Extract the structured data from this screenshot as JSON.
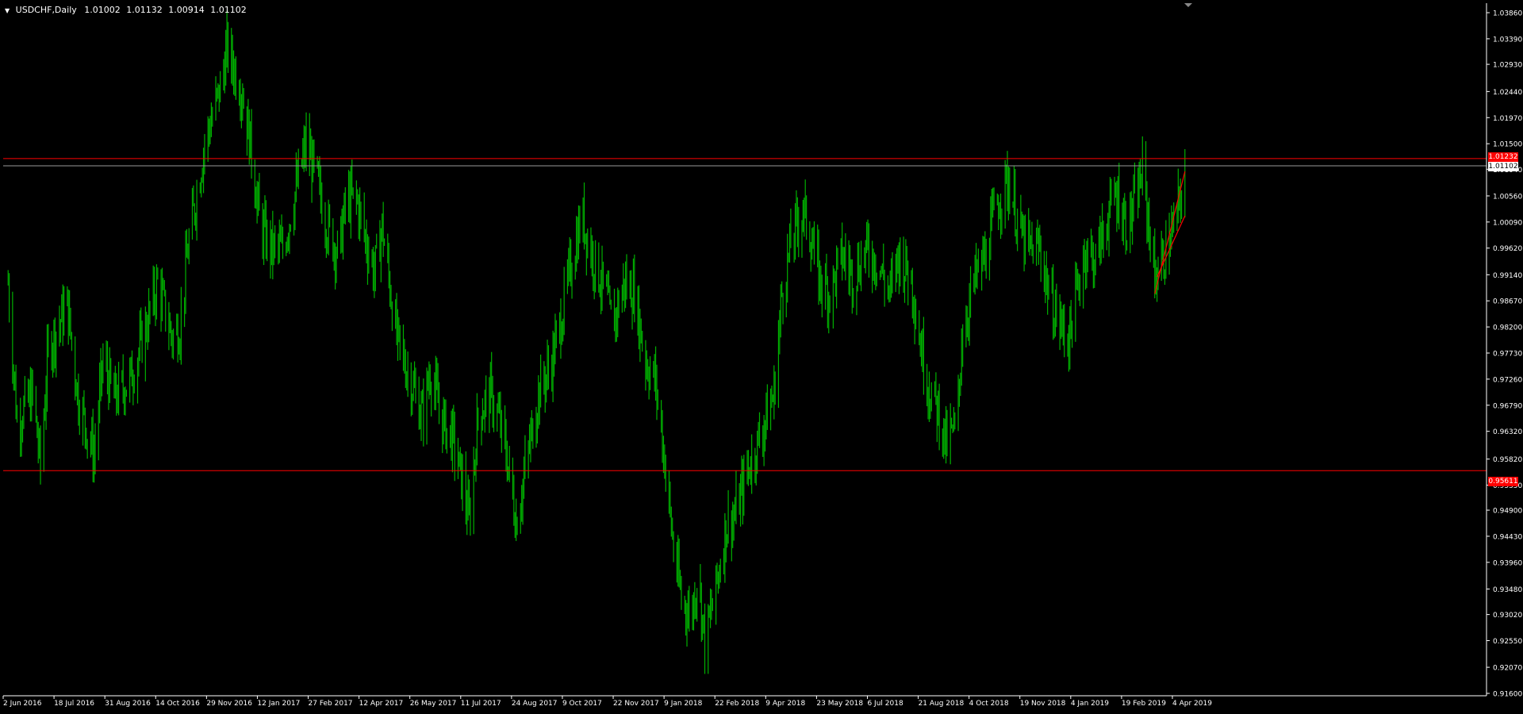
{
  "header": {
    "symbol": "USDCHF,Daily",
    "open": "1.01002",
    "high": "1.01132",
    "low": "1.00914",
    "close": "1.01102"
  },
  "price_tags": {
    "upper_level": "1.01232",
    "current": "1.01102",
    "lower_level": "0.95611"
  },
  "colors": {
    "background": "#000000",
    "candle": "#00b000",
    "level_line": "#ff0000",
    "current_line": "#9a9a9a",
    "axis": "#ffffff",
    "trend": "#ff0000"
  },
  "chart_data": {
    "type": "bar",
    "style": "ohlc-bars",
    "title": "USDCHF,Daily",
    "y_ticks": [
      "1.03860",
      "1.03390",
      "1.02930",
      "1.02440",
      "1.01970",
      "1.01500",
      "1.01040",
      "1.00560",
      "1.00090",
      "0.99620",
      "0.99140",
      "0.98670",
      "0.98200",
      "0.97730",
      "0.97260",
      "0.96790",
      "0.96320",
      "0.95820",
      "0.95350",
      "0.94900",
      "0.94430",
      "0.93960",
      "0.93480",
      "0.93020",
      "0.92550",
      "0.92070",
      "0.91600"
    ],
    "x_ticks": [
      "2 Jun 2016",
      "18 Jul 2016",
      "31 Aug 2016",
      "14 Oct 2016",
      "29 Nov 2016",
      "12 Jan 2017",
      "27 Feb 2017",
      "12 Apr 2017",
      "26 May 2017",
      "11 Jul 2017",
      "24 Aug 2017",
      "9 Oct 2017",
      "22 Nov 2017",
      "9 Jan 2018",
      "22 Feb 2018",
      "9 Apr 2018",
      "23 May 2018",
      "6 Jul 2018",
      "21 Aug 2018",
      "4 Oct 2018",
      "19 Nov 2018",
      "4 Jan 2019",
      "19 Feb 2019",
      "4 Apr 2019"
    ],
    "ylim": [
      0.916,
      1.0386
    ],
    "horizontal_levels": [
      {
        "name": "upper_level",
        "price": 1.01232
      },
      {
        "name": "current",
        "price": 1.01102
      },
      {
        "name": "lower_level",
        "price": 0.95611
      }
    ],
    "close_path": [
      {
        "date": "2016-06-02",
        "close": 0.99
      },
      {
        "date": "2016-06-10",
        "close": 0.965
      },
      {
        "date": "2016-06-24",
        "close": 0.97
      },
      {
        "date": "2016-07-01",
        "close": 0.957
      },
      {
        "date": "2016-07-08",
        "close": 0.978
      },
      {
        "date": "2016-07-25",
        "close": 0.986
      },
      {
        "date": "2016-08-04",
        "close": 0.969
      },
      {
        "date": "2016-08-18",
        "close": 0.959
      },
      {
        "date": "2016-08-26",
        "close": 0.976
      },
      {
        "date": "2016-09-05",
        "close": 0.969
      },
      {
        "date": "2016-09-20",
        "close": 0.973
      },
      {
        "date": "2016-10-01",
        "close": 0.98
      },
      {
        "date": "2016-10-14",
        "close": 0.99
      },
      {
        "date": "2016-10-27",
        "close": 0.98
      },
      {
        "date": "2016-11-03",
        "close": 0.982
      },
      {
        "date": "2016-11-10",
        "close": 0.996
      },
      {
        "date": "2016-11-25",
        "close": 1.015
      },
      {
        "date": "2016-12-09",
        "close": 1.025
      },
      {
        "date": "2016-12-15",
        "close": 1.032
      },
      {
        "date": "2016-12-28",
        "close": 1.025
      },
      {
        "date": "2017-01-05",
        "close": 1.015
      },
      {
        "date": "2017-01-14",
        "close": 1.0
      },
      {
        "date": "2017-01-24",
        "close": 0.996
      },
      {
        "date": "2017-02-03",
        "close": 0.996
      },
      {
        "date": "2017-02-14",
        "close": 1.006
      },
      {
        "date": "2017-02-24",
        "close": 1.015
      },
      {
        "date": "2017-03-06",
        "close": 1.008
      },
      {
        "date": "2017-03-15",
        "close": 1.0
      },
      {
        "date": "2017-03-25",
        "close": 0.995
      },
      {
        "date": "2017-04-01",
        "close": 1.005
      },
      {
        "date": "2017-04-10",
        "close": 1.005
      },
      {
        "date": "2017-04-18",
        "close": 0.998
      },
      {
        "date": "2017-04-26",
        "close": 0.992
      },
      {
        "date": "2017-05-03",
        "close": 1.0
      },
      {
        "date": "2017-05-16",
        "close": 0.98
      },
      {
        "date": "2017-05-29",
        "close": 0.972
      },
      {
        "date": "2017-06-08",
        "close": 0.966
      },
      {
        "date": "2017-06-15",
        "close": 0.974
      },
      {
        "date": "2017-06-26",
        "close": 0.965
      },
      {
        "date": "2017-07-05",
        "close": 0.962
      },
      {
        "date": "2017-07-15",
        "close": 0.953
      },
      {
        "date": "2017-07-20",
        "close": 0.947
      },
      {
        "date": "2017-07-28",
        "close": 0.966
      },
      {
        "date": "2017-08-08",
        "close": 0.97
      },
      {
        "date": "2017-08-16",
        "close": 0.965
      },
      {
        "date": "2017-08-24",
        "close": 0.957
      },
      {
        "date": "2017-08-31",
        "close": 0.947
      },
      {
        "date": "2017-09-08",
        "close": 0.956
      },
      {
        "date": "2017-09-20",
        "close": 0.97
      },
      {
        "date": "2017-10-01",
        "close": 0.975
      },
      {
        "date": "2017-10-09",
        "close": 0.982
      },
      {
        "date": "2017-10-21",
        "close": 0.995
      },
      {
        "date": "2017-10-29",
        "close": 1.002
      },
      {
        "date": "2017-11-07",
        "close": 0.995
      },
      {
        "date": "2017-11-19",
        "close": 0.988
      },
      {
        "date": "2017-11-25",
        "close": 0.982
      },
      {
        "date": "2017-12-06",
        "close": 0.99
      },
      {
        "date": "2017-12-15",
        "close": 0.988
      },
      {
        "date": "2017-12-25",
        "close": 0.976
      },
      {
        "date": "2018-01-03",
        "close": 0.972
      },
      {
        "date": "2018-01-10",
        "close": 0.96
      },
      {
        "date": "2018-01-19",
        "close": 0.942
      },
      {
        "date": "2018-01-26",
        "close": 0.933
      },
      {
        "date": "2018-02-04",
        "close": 0.93
      },
      {
        "date": "2018-02-10",
        "close": 0.938
      },
      {
        "date": "2018-02-16",
        "close": 0.925
      },
      {
        "date": "2018-02-26",
        "close": 0.935
      },
      {
        "date": "2018-03-07",
        "close": 0.946
      },
      {
        "date": "2018-03-15",
        "close": 0.948
      },
      {
        "date": "2018-03-26",
        "close": 0.956
      },
      {
        "date": "2018-04-06",
        "close": 0.962
      },
      {
        "date": "2018-04-19",
        "close": 0.97
      },
      {
        "date": "2018-04-26",
        "close": 0.988
      },
      {
        "date": "2018-05-05",
        "close": 0.998
      },
      {
        "date": "2018-05-15",
        "close": 1.003
      },
      {
        "date": "2018-05-20",
        "close": 1.0
      },
      {
        "date": "2018-05-29",
        "close": 0.991
      },
      {
        "date": "2018-06-08",
        "close": 0.988
      },
      {
        "date": "2018-06-19",
        "close": 0.995
      },
      {
        "date": "2018-06-29",
        "close": 0.991
      },
      {
        "date": "2018-07-10",
        "close": 0.996
      },
      {
        "date": "2018-07-20",
        "close": 0.994
      },
      {
        "date": "2018-08-01",
        "close": 0.988
      },
      {
        "date": "2018-08-08",
        "close": 0.995
      },
      {
        "date": "2018-08-20",
        "close": 0.991
      },
      {
        "date": "2018-08-28",
        "close": 0.979
      },
      {
        "date": "2018-09-06",
        "close": 0.97
      },
      {
        "date": "2018-09-13",
        "close": 0.967
      },
      {
        "date": "2018-09-20",
        "close": 0.961
      },
      {
        "date": "2018-09-30",
        "close": 0.964
      },
      {
        "date": "2018-10-04",
        "close": 0.98
      },
      {
        "date": "2018-10-15",
        "close": 0.99
      },
      {
        "date": "2018-10-26",
        "close": 0.995
      },
      {
        "date": "2018-11-03",
        "close": 1.003
      },
      {
        "date": "2018-11-13",
        "close": 1.008
      },
      {
        "date": "2018-11-17",
        "close": 1.007
      },
      {
        "date": "2018-11-25",
        "close": 0.999
      },
      {
        "date": "2018-12-03",
        "close": 0.996
      },
      {
        "date": "2018-12-13",
        "close": 0.996
      },
      {
        "date": "2018-12-24",
        "close": 0.986
      },
      {
        "date": "2019-01-02",
        "close": 0.982
      },
      {
        "date": "2019-01-08",
        "close": 0.98
      },
      {
        "date": "2019-01-15",
        "close": 0.988
      },
      {
        "date": "2019-01-23",
        "close": 0.996
      },
      {
        "date": "2019-02-01",
        "close": 0.994
      },
      {
        "date": "2019-02-12",
        "close": 1.002
      },
      {
        "date": "2019-02-20",
        "close": 1.006
      },
      {
        "date": "2019-03-01",
        "close": 1.0
      },
      {
        "date": "2019-03-08",
        "close": 1.004
      },
      {
        "date": "2019-03-15",
        "close": 1.01
      },
      {
        "date": "2019-03-22",
        "close": 0.998
      },
      {
        "date": "2019-03-26",
        "close": 0.991
      },
      {
        "date": "2019-04-04",
        "close": 0.995
      },
      {
        "date": "2019-04-12",
        "close": 1.0
      },
      {
        "date": "2019-04-18",
        "close": 1.005
      },
      {
        "date": "2019-04-22",
        "close": 1.011
      }
    ],
    "trend_lines": [
      {
        "from": {
          "date": "2019-03-26",
          "price": 0.988
        },
        "to": {
          "date": "2019-04-22",
          "price": 1.01
        }
      },
      {
        "from": {
          "date": "2019-03-28",
          "price": 0.991
        },
        "to": {
          "date": "2019-04-22",
          "price": 1.002
        }
      }
    ]
  }
}
